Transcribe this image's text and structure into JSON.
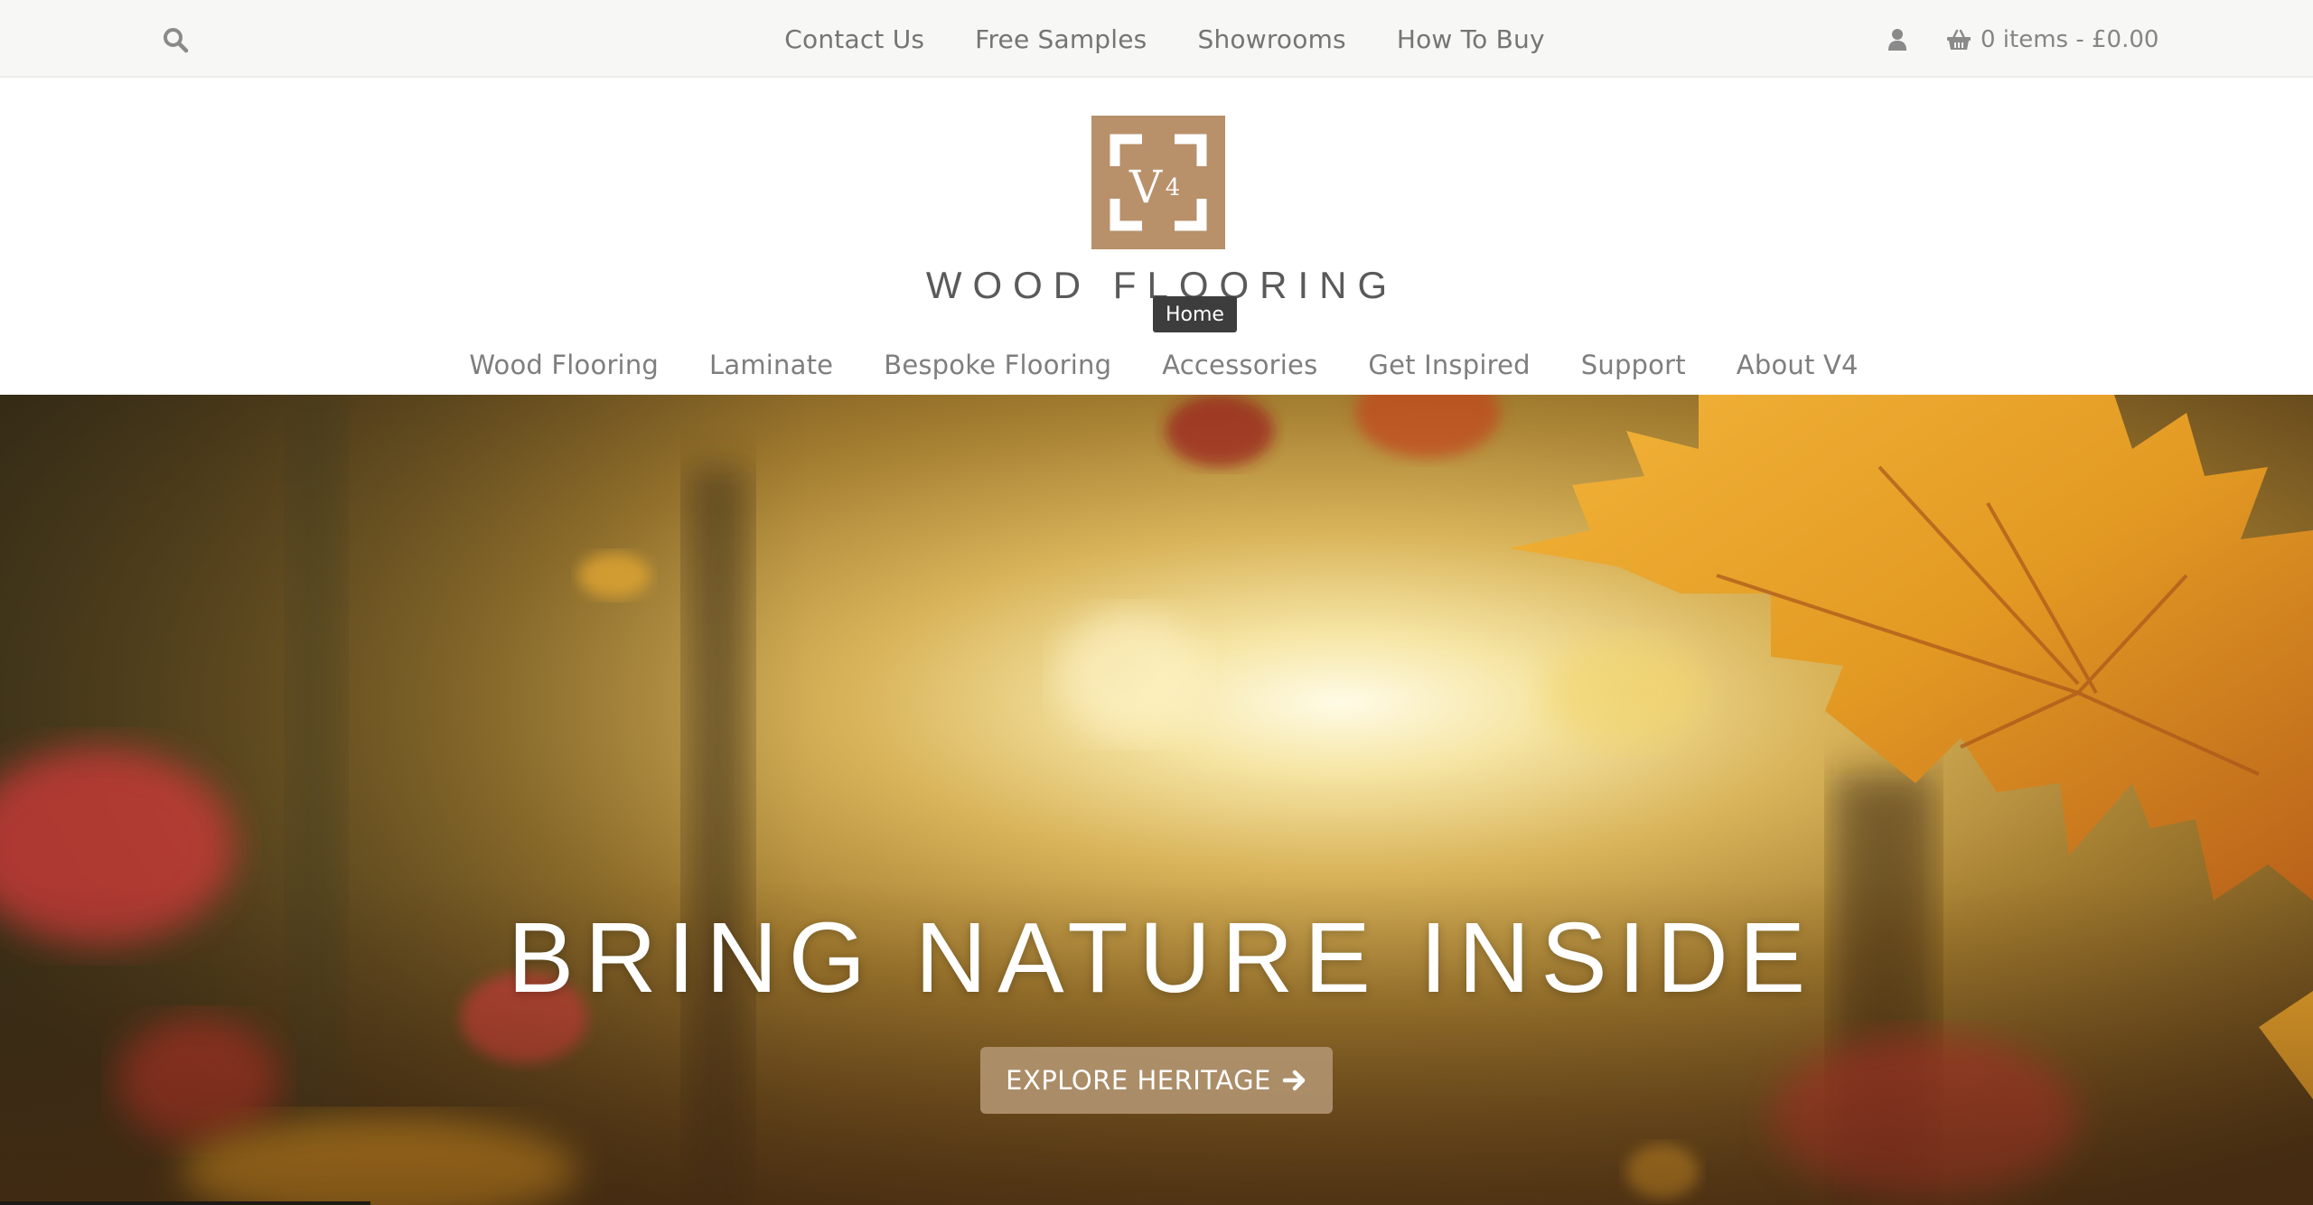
{
  "topbar": {
    "search_icon": "search-icon",
    "links": [
      "Contact Us",
      "Free Samples",
      "Showrooms",
      "How To Buy"
    ],
    "account_icon": "user-icon",
    "cart_icon": "basket-icon",
    "cart_label": "0 items - £0.00"
  },
  "header": {
    "logo_mark": "V4",
    "logo_text": "WOOD FLOORING",
    "tooltip": "Home"
  },
  "nav": {
    "items": [
      "Wood Flooring",
      "Laminate",
      "Bespoke Flooring",
      "Accessories",
      "Get Inspired",
      "Support",
      "About V4"
    ]
  },
  "hero": {
    "title": "BRING NATURE INSIDE",
    "button_label": "EXPLORE HERITAGE",
    "button_icon": "arrow-right-icon"
  },
  "colors": {
    "brand": "#b8906a",
    "topbar_bg": "#f7f7f5",
    "nav_text": "#7e7e7e",
    "button_bg": "#b0936f"
  }
}
